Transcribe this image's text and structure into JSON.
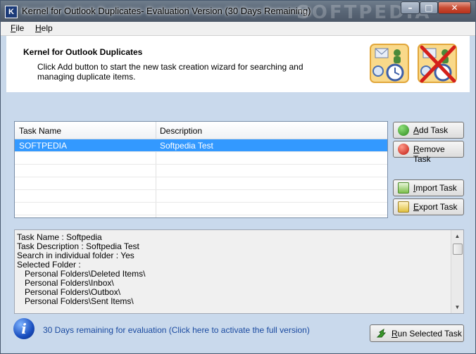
{
  "window": {
    "title": "Kernel for Outlook Duplicates- Evaluation Version (30 Days Remaining)",
    "app_icon_letter": "K",
    "watermark": "SOFTPEDIA",
    "controls": {
      "minimize": "–",
      "maximize": "□",
      "close": "✕"
    }
  },
  "menu": {
    "items": [
      {
        "underline": "F",
        "rest": "ile"
      },
      {
        "underline": "H",
        "rest": "elp"
      }
    ]
  },
  "header": {
    "title": "Kernel for Outlook Duplicates",
    "description": "Click Add button to start the new task creation wizard for searching and managing duplicate items."
  },
  "grid": {
    "columns": [
      "Task Name",
      "Description"
    ],
    "rows": [
      {
        "name": "SOFTPEDIA",
        "description": "Softpedia Test",
        "selected": true
      }
    ],
    "empty_rows": 6
  },
  "buttons": {
    "add": {
      "underline": "A",
      "rest": "dd Task"
    },
    "remove": {
      "underline": "R",
      "rest": "emove Task"
    },
    "import": {
      "underline": "I",
      "rest": "mport Task"
    },
    "export": {
      "underline": "E",
      "rest": "xport Task"
    },
    "run": {
      "underline": "R",
      "rest": "un Selected Task"
    }
  },
  "details": {
    "lines": [
      "Task Name : Softpedia",
      "Task Description : Softpedia Test",
      "Search in individual folder : Yes",
      "Selected Folder :",
      "Personal Folders\\Deleted Items\\",
      "Personal Folders\\Inbox\\",
      "Personal Folders\\Outbox\\",
      "Personal Folders\\Sent Items\\"
    ]
  },
  "status": {
    "activate_text": "30 Days remaining for evaluation (Click here to activate the full version)"
  },
  "colors": {
    "selection": "#3399ff",
    "panel": "#c9d9ec",
    "link": "#1a4aa0"
  }
}
